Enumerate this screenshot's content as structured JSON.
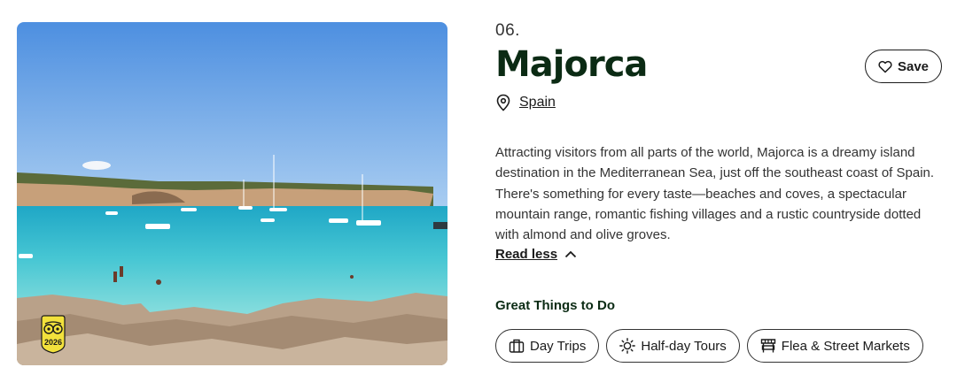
{
  "destination": {
    "rank": "06.",
    "name": "Majorca",
    "country_link": "Spain",
    "description": "Attracting visitors from all parts of the world, Majorca is a dreamy island destination in the Mediterranean Sea, just off the southeast coast of Spain. There's something for every taste—beaches and coves, a spectacular mountain range, romantic fishing villages and a rustic countryside dotted with almond and olive groves.",
    "read_less_label": "Read less",
    "photo_badge_year": "2026"
  },
  "actions": {
    "save_label": "Save"
  },
  "things_to_do": {
    "heading": "Great Things to Do",
    "chips": [
      {
        "label": "Day Trips",
        "icon": "suitcase-icon"
      },
      {
        "label": "Half-day Tours",
        "icon": "sun-icon"
      },
      {
        "label": "Flea & Street Markets",
        "icon": "market-stall-icon"
      }
    ]
  },
  "colors": {
    "title": "#0b2b14",
    "badge": "#f2e13c",
    "sea": "#46c6d3"
  }
}
